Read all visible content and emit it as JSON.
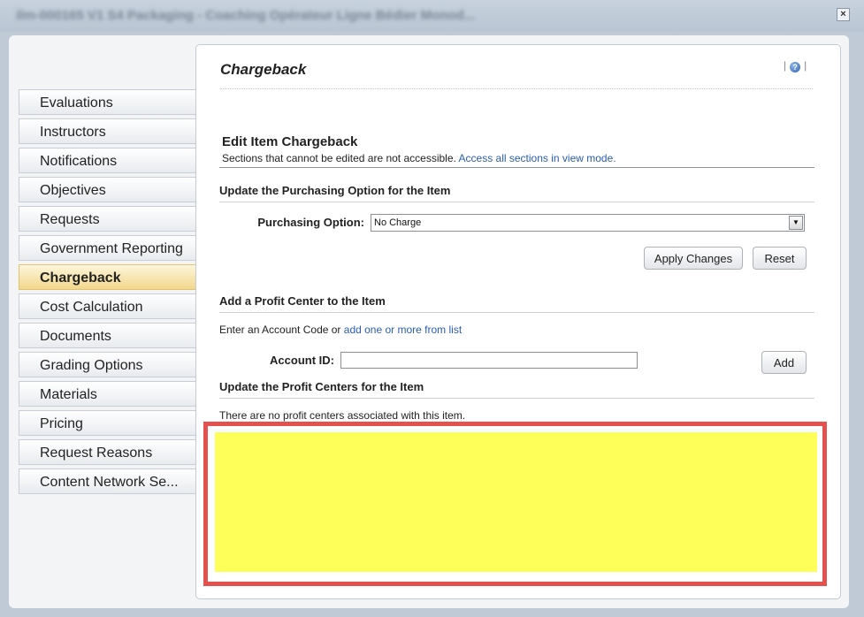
{
  "window": {
    "title": "ilm-000165 V1 S4 Packaging - Coaching Opérateur Ligne Bédier Monod...",
    "close_label": "×"
  },
  "sidebar": {
    "items": [
      {
        "label": "Evaluations"
      },
      {
        "label": "Instructors"
      },
      {
        "label": "Notifications"
      },
      {
        "label": "Objectives"
      },
      {
        "label": "Requests"
      },
      {
        "label": "Government Reporting"
      },
      {
        "label": "Chargeback",
        "active": true
      },
      {
        "label": "Cost Calculation"
      },
      {
        "label": "Documents"
      },
      {
        "label": "Grading Options"
      },
      {
        "label": "Materials"
      },
      {
        "label": "Pricing"
      },
      {
        "label": "Request Reasons"
      },
      {
        "label": "Content Network Se..."
      }
    ]
  },
  "main": {
    "title": "Chargeback",
    "help_separator": "|",
    "help_icon": "help-icon",
    "edit": {
      "heading": "Edit Item Chargeback",
      "note": "Sections that cannot be edited are not accessible.",
      "note_link": "Access all sections in view mode."
    },
    "purchasing": {
      "heading": "Update the Purchasing Option for the Item",
      "label": "Purchasing Option:",
      "value": "No Charge",
      "apply_label": "Apply Changes",
      "reset_label": "Reset"
    },
    "profit_center": {
      "heading": "Add a Profit Center to the Item",
      "prompt": "Enter an Account Code or",
      "prompt_link": "add one or more from list",
      "account_label": "Account ID:",
      "account_value": "",
      "add_label": "Add"
    },
    "update_profit": {
      "heading": "Update the Profit Centers for the Item",
      "empty_message": "There are no profit centers associated with this item."
    }
  },
  "colors": {
    "highlight": "#ffff59",
    "annotation_border": "#e4514e",
    "link": "#2a5db0",
    "active_tab": "#f2d78c"
  }
}
